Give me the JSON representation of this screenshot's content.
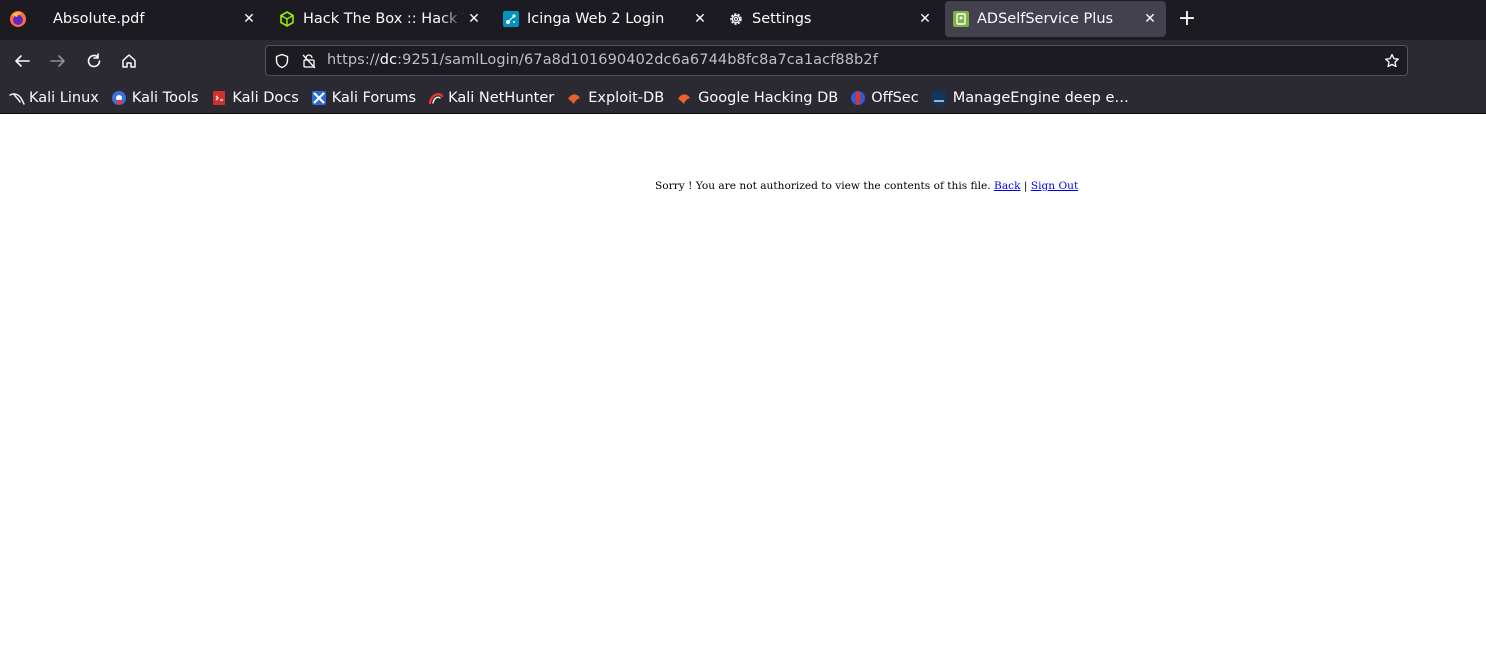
{
  "tabs": [
    {
      "label": "Absolute.pdf",
      "icon": "pdf-icon",
      "active": false
    },
    {
      "label": "Hack The Box :: Hack The Box",
      "icon": "hackthebox-icon",
      "active": false
    },
    {
      "label": "Icinga Web 2 Login",
      "icon": "icinga-icon",
      "active": false
    },
    {
      "label": "Settings",
      "icon": "gear-icon",
      "active": false
    },
    {
      "label": "ADSelfService Plus",
      "icon": "adselfservice-icon",
      "active": true
    }
  ],
  "address": {
    "scheme": "https://",
    "host": "dc",
    "rest": ":9251/samlLogin/67a8d101690402dc6a6744b8fc8a7ca1acf88b2f"
  },
  "bookmarks": [
    {
      "label": "Kali Linux",
      "icon": "kali-dragon-icon"
    },
    {
      "label": "Kali Tools",
      "icon": "kali-tools-icon"
    },
    {
      "label": "Kali Docs",
      "icon": "kali-docs-icon"
    },
    {
      "label": "Kali Forums",
      "icon": "kali-forums-icon"
    },
    {
      "label": "Kali NetHunter",
      "icon": "nethunter-icon"
    },
    {
      "label": "Exploit-DB",
      "icon": "exploitdb-icon"
    },
    {
      "label": "Google Hacking DB",
      "icon": "ghdb-icon"
    },
    {
      "label": "OffSec",
      "icon": "offsec-icon"
    },
    {
      "label": "ManageEngine deep e…",
      "icon": "manageengine-icon"
    }
  ],
  "page": {
    "message": "Sorry ! You are not authorized to view the contents of this file.",
    "back_link": "Back",
    "separator": "|",
    "signout_link": "Sign Out"
  },
  "colors": {
    "tabbar_bg": "#1c1b22",
    "toolbar_bg": "#2b2a33",
    "active_tab_bg": "#42414d",
    "link": "#0000ee"
  }
}
